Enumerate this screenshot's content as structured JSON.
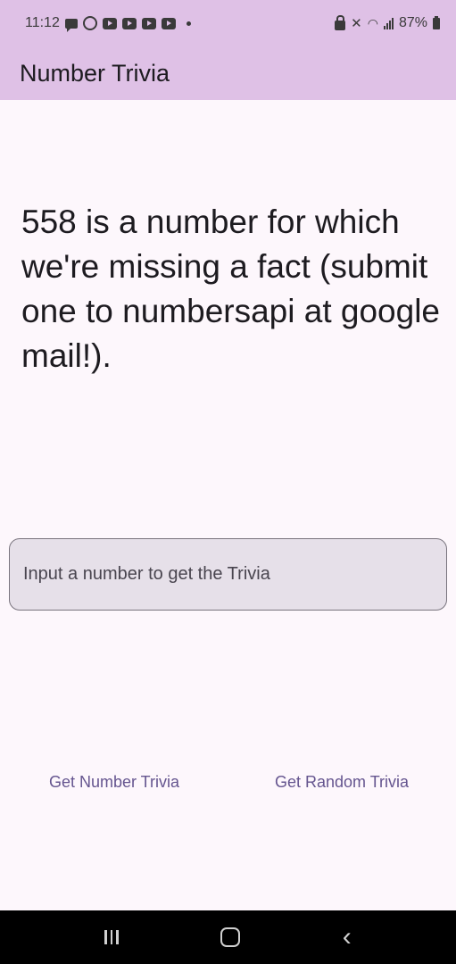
{
  "status_bar": {
    "time": "11:12",
    "battery": "87%",
    "left_icons": [
      "message-icon",
      "whatsapp-icon",
      "youtube-icon",
      "youtube-icon",
      "youtube-icon",
      "youtube-icon",
      "dot-icon"
    ],
    "right_icons": [
      "lock-icon",
      "mute-icon",
      "wifi-icon",
      "signal-icon",
      "battery-icon"
    ]
  },
  "app_bar": {
    "title": "Number Trivia",
    "background": "#dfc1e6"
  },
  "main": {
    "trivia_text": "558 is a number for which we're missing a fact (submit one to numbersapi at google mail!).",
    "input": {
      "placeholder": "Input a number to get the Trivia",
      "value": ""
    },
    "buttons": {
      "number_trivia": "Get Number Trivia",
      "random_trivia": "Get Random Trivia"
    },
    "accent_color": "#65558f"
  },
  "nav_bar": {
    "icons": [
      "recent-apps-icon",
      "home-icon",
      "back-icon"
    ]
  }
}
